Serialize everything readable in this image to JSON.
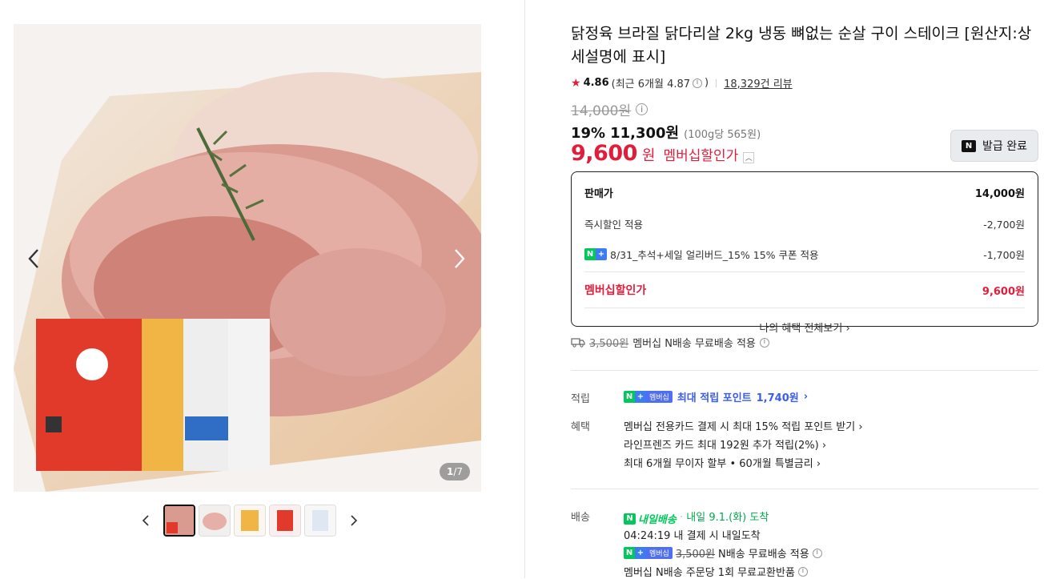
{
  "gallery": {
    "counter_current": "1",
    "counter_total": "/7",
    "prev_label": "이전 이미지",
    "next_label": "다음 이미지",
    "thumbnail_count": 5
  },
  "product": {
    "title": "닭정육 브라질 닭다리살 2kg 냉동 뼈없는 순살 구이 스테이크 [원산지:상세설명에 표시]",
    "rating": "4.86",
    "recent_rating": "(최근 6개월 4.87",
    "recent_close": ")",
    "reviews": "18,329건 리뷰",
    "original_price": "14,000원",
    "discount_pct": "19%",
    "sale_price": "11,300원",
    "unit_price": "(100g당 565원)",
    "member_price": "9,600",
    "member_won": "원",
    "member_label": "멤버십할인가",
    "coupon_button": "발급 완료",
    "coupon_badge": "N"
  },
  "price_box": {
    "row1_label": "판매가",
    "row1_value": "14,000원",
    "row2_label": "즉시할인 적용",
    "row2_value": "-2,700원",
    "row3_label": "8/31_추석+세일 얼리버드_15% 15% 쿠폰 적용",
    "row3_value": "-1,700원",
    "row4_label": "멤버십할인가",
    "row4_value": "9,600원",
    "all_benefits": "나의 혜택 전체보기"
  },
  "shipping": {
    "fee": "3,500원",
    "text": "멤버십 N배송 무료배송 적용"
  },
  "points": {
    "label": "적립",
    "badge": "멤버십",
    "text": "최대 적립 포인트",
    "amount": "1,740원"
  },
  "benefits": {
    "label": "혜택",
    "items": [
      "멤버십 전용카드 결제 시 최대 15% 적립 포인트 받기",
      "라인프렌즈 카드 최대 192원 추가 적립(2%)",
      "최대 6개월 무이자 할부 • 60개월 특별금리"
    ]
  },
  "delivery": {
    "label": "배송",
    "logo": "내일배송",
    "arrival": "내일 9.1.(화) 도착",
    "timer": "04:24:19",
    "timer_text": "내 결제 시 내일도착",
    "badge": "멤버십",
    "fee": "3,500원",
    "fee_text": "N배송 무료배송 적용",
    "exchange": "멤버십 N배송 주문당 1회 무료교환반품"
  },
  "colors": {
    "accent_red": "#e01e3c",
    "npay_green": "#03c75a",
    "point_blue": "#3a5cf0"
  }
}
